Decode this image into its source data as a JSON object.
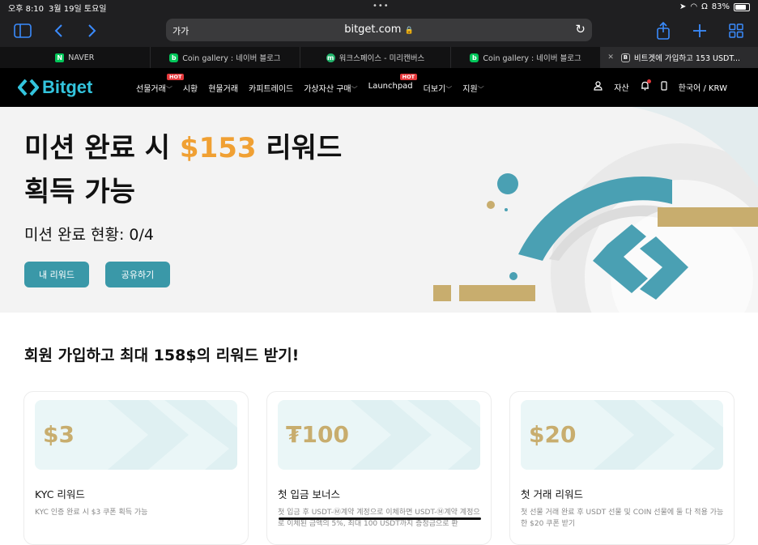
{
  "statusbar": {
    "time": "오후 8:10",
    "date": "3월 19일 토요일",
    "battery": "83%",
    "battery_level": 0.83,
    "dots": "•••"
  },
  "browser": {
    "aa_label": "가가",
    "host": "bitget.com",
    "lock_icon": "🔒",
    "reload_icon": "↻",
    "tabs": [
      {
        "title": "NAVER",
        "icon": "naver"
      },
      {
        "title": "Coin gallery : 네이버 블로그",
        "icon": "blog"
      },
      {
        "title": "워크스페이스 - 미리캔버스",
        "icon": "workspace"
      },
      {
        "title": "Coin gallery : 네이버 블로그",
        "icon": "blog"
      },
      {
        "title": "비트겟에 가입하고 153 USDT...",
        "icon": "bitget",
        "active": true
      }
    ]
  },
  "nav": {
    "logo": "Bitget",
    "items": [
      {
        "label": "선물거래",
        "hot": "HOT",
        "chevron": "﹀"
      },
      {
        "label": "시황"
      },
      {
        "label": "현물거래"
      },
      {
        "label": "카피트레이드"
      },
      {
        "label": "가상자산 구매",
        "chevron": "﹀"
      },
      {
        "label": "Launchpad",
        "hot": "HOT"
      },
      {
        "label": "더보기",
        "chevron": "﹀"
      },
      {
        "label": "지원",
        "chevron": "﹀"
      }
    ],
    "assets": "자산",
    "language": "한국어 / KRW"
  },
  "hero": {
    "title_prefix": "미션 완료 시 ",
    "title_amount": "$153",
    "title_suffix": " 리워드",
    "title_line2": "획득 가능",
    "progress": "미션 완료 현황: 0/4",
    "btn_rewards": "내 리워드",
    "btn_share": "공유하기"
  },
  "section": {
    "title": "회원 가입하고 최대 158$의 리워드 받기!"
  },
  "cards": [
    {
      "amount": "$3",
      "title": "KYC 리워드",
      "desc": "KYC 인증 완료 시 $3 쿠폰 획득 가능"
    },
    {
      "amount": "₮100",
      "title": "첫 입금 보너스",
      "desc": "첫 입금 후 USDT-Ⓜ계약 계정으로 이체하면 USDT-Ⓜ계약 계정으로 이체된 금액의 5%, 최대 100 USDT까지 증정금으로 환"
    },
    {
      "amount": "$20",
      "title": "첫 거래 리워드",
      "desc": "첫 선물 거래 완료 후 USDT 선물 및 COIN 선물에 둘 다 적용 가능한 $20 쿠폰 받기"
    }
  ],
  "colors": {
    "accent": "#3a98a8",
    "gold": "#c8ad6e",
    "orange": "#f0a033",
    "logo": "#33c4dd"
  }
}
